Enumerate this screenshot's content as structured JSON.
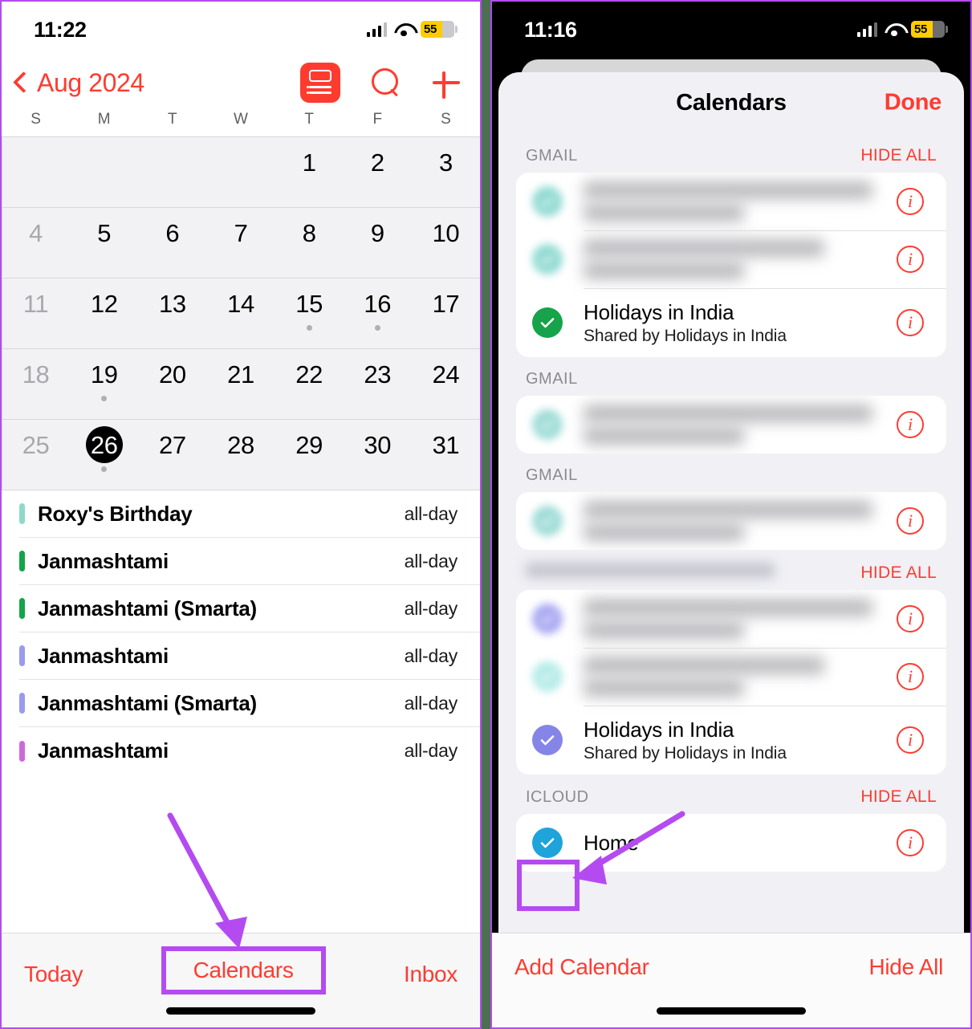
{
  "left_phone": {
    "status_bar": {
      "time": "11:22",
      "battery_level": "55",
      "signal_icon": "cellular-signal-icon",
      "wifi_icon": "wifi-icon",
      "battery_icon": "battery-icon"
    },
    "nav": {
      "back_icon": "chevron-left-icon",
      "month_title": "Aug 2024",
      "list_view_icon": "list-view-icon",
      "search_icon": "search-icon",
      "add_icon": "plus-icon"
    },
    "weekdays": [
      "S",
      "M",
      "T",
      "W",
      "T",
      "F",
      "S"
    ],
    "month_grid": [
      [
        {
          "n": "",
          "dim": false,
          "dot": false,
          "today": false
        },
        {
          "n": "",
          "dim": false,
          "dot": false,
          "today": false
        },
        {
          "n": "",
          "dim": false,
          "dot": false,
          "today": false
        },
        {
          "n": "",
          "dim": false,
          "dot": false,
          "today": false
        },
        {
          "n": "1",
          "dim": false,
          "dot": false,
          "today": false
        },
        {
          "n": "2",
          "dim": false,
          "dot": false,
          "today": false
        },
        {
          "n": "3",
          "dim": false,
          "dot": false,
          "today": false
        }
      ],
      [
        {
          "n": "4",
          "dim": true,
          "dot": false,
          "today": false
        },
        {
          "n": "5",
          "dim": false,
          "dot": false,
          "today": false
        },
        {
          "n": "6",
          "dim": false,
          "dot": false,
          "today": false
        },
        {
          "n": "7",
          "dim": false,
          "dot": false,
          "today": false
        },
        {
          "n": "8",
          "dim": false,
          "dot": false,
          "today": false
        },
        {
          "n": "9",
          "dim": false,
          "dot": false,
          "today": false
        },
        {
          "n": "10",
          "dim": false,
          "dot": false,
          "today": false
        }
      ],
      [
        {
          "n": "11",
          "dim": true,
          "dot": false,
          "today": false
        },
        {
          "n": "12",
          "dim": false,
          "dot": false,
          "today": false
        },
        {
          "n": "13",
          "dim": false,
          "dot": false,
          "today": false
        },
        {
          "n": "14",
          "dim": false,
          "dot": false,
          "today": false
        },
        {
          "n": "15",
          "dim": false,
          "dot": true,
          "today": false
        },
        {
          "n": "16",
          "dim": false,
          "dot": true,
          "today": false
        },
        {
          "n": "17",
          "dim": false,
          "dot": false,
          "today": false
        }
      ],
      [
        {
          "n": "18",
          "dim": true,
          "dot": false,
          "today": false
        },
        {
          "n": "19",
          "dim": false,
          "dot": true,
          "today": false
        },
        {
          "n": "20",
          "dim": false,
          "dot": false,
          "today": false
        },
        {
          "n": "21",
          "dim": false,
          "dot": false,
          "today": false
        },
        {
          "n": "22",
          "dim": false,
          "dot": false,
          "today": false
        },
        {
          "n": "23",
          "dim": false,
          "dot": false,
          "today": false
        },
        {
          "n": "24",
          "dim": false,
          "dot": false,
          "today": false
        }
      ],
      [
        {
          "n": "25",
          "dim": true,
          "dot": false,
          "today": false
        },
        {
          "n": "26",
          "dim": false,
          "dot": true,
          "today": true
        },
        {
          "n": "27",
          "dim": false,
          "dot": false,
          "today": false
        },
        {
          "n": "28",
          "dim": false,
          "dot": false,
          "today": false
        },
        {
          "n": "29",
          "dim": false,
          "dot": false,
          "today": false
        },
        {
          "n": "30",
          "dim": false,
          "dot": false,
          "today": false
        },
        {
          "n": "31",
          "dim": false,
          "dot": false,
          "today": false
        }
      ]
    ],
    "events": [
      {
        "title": "Roxy's Birthday",
        "time": "all-day",
        "color": "#8FD9C8"
      },
      {
        "title": "Janmashtami",
        "time": "all-day",
        "color": "#14A44A"
      },
      {
        "title": "Janmashtami (Smarta)",
        "time": "all-day",
        "color": "#14A44A"
      },
      {
        "title": "Janmashtami",
        "time": "all-day",
        "color": "#9A9AF0"
      },
      {
        "title": "Janmashtami (Smarta)",
        "time": "all-day",
        "color": "#9A9AF0"
      },
      {
        "title": "Janmashtami",
        "time": "all-day",
        "color": "#D068DC"
      }
    ],
    "bottom_bar": {
      "today_label": "Today",
      "calendars_label": "Calendars",
      "inbox_label": "Inbox"
    }
  },
  "right_phone": {
    "status_bar": {
      "time": "11:16",
      "battery_level": "55",
      "signal_icon": "cellular-signal-icon",
      "wifi_icon": "wifi-icon",
      "battery_icon": "battery-icon"
    },
    "sheet": {
      "title": "Calendars",
      "done_label": "Done",
      "sections": [
        {
          "label": "GMAIL",
          "label_blurred": false,
          "hide_all": "HIDE ALL",
          "rows": [
            {
              "name": "",
              "sub": "",
              "blurred": true,
              "check_color": "#7FD4CB",
              "checked": true
            },
            {
              "name": "",
              "sub": "",
              "blurred": true,
              "check_color": "#7FD4CB",
              "checked": true
            },
            {
              "name": "Holidays in India",
              "sub": "Shared by Holidays in India",
              "blurred": false,
              "check_color": "#16A34A",
              "checked": true
            }
          ]
        },
        {
          "label": "GMAIL",
          "label_blurred": false,
          "hide_all": "",
          "rows": [
            {
              "name": "",
              "sub": "",
              "blurred": true,
              "check_color": "#8ED6D0",
              "checked": true
            }
          ]
        },
        {
          "label": "GMAIL",
          "label_blurred": false,
          "hide_all": "",
          "rows": [
            {
              "name": "",
              "sub": "",
              "blurred": true,
              "check_color": "#8ED6D0",
              "checked": true
            }
          ]
        },
        {
          "label": "",
          "label_blurred": true,
          "hide_all": "HIDE ALL",
          "rows": [
            {
              "name": "",
              "sub": "",
              "blurred": true,
              "check_color": "#9A9AF0",
              "checked": true
            },
            {
              "name": "",
              "sub": "",
              "blurred": true,
              "check_color": "#A8E8E4",
              "checked": true
            },
            {
              "name": "Holidays in India",
              "sub": "Shared by Holidays in India",
              "blurred": false,
              "check_color": "#8585E8",
              "checked": true
            }
          ]
        },
        {
          "label": "ICLOUD",
          "label_blurred": false,
          "hide_all": "HIDE ALL",
          "rows": [
            {
              "name": "Home",
              "sub": "",
              "blurred": false,
              "check_color": "#1FA3DB",
              "checked": true
            }
          ]
        }
      ],
      "info_icon": "info-circle-icon"
    },
    "bottom_bar": {
      "add_calendar_label": "Add Calendar",
      "hide_all_label": "Hide All"
    }
  },
  "annotations": {
    "highlight_color": "#b44bf0",
    "arrow_icon": "arrow-pointer-icon"
  }
}
